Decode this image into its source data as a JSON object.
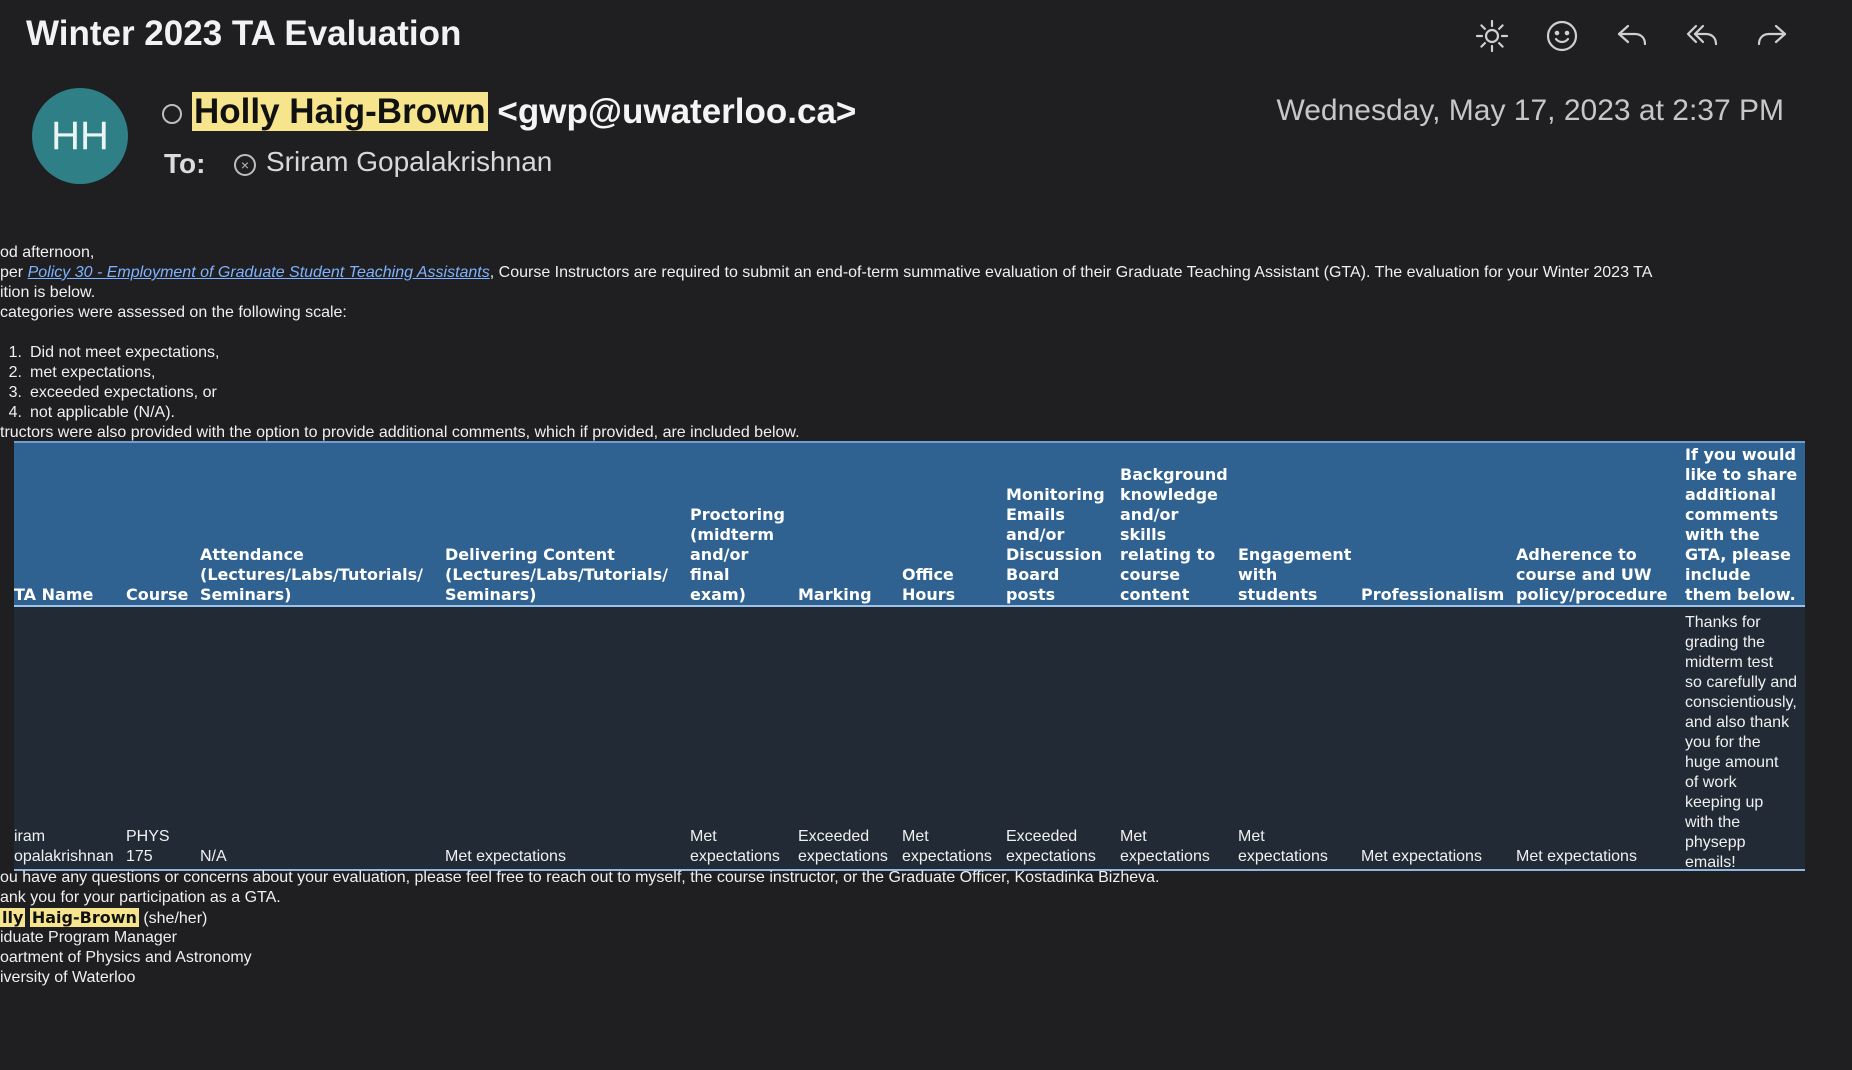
{
  "subject": "Winter 2023 TA Evaluation",
  "toolbar": [
    "sun-icon",
    "emoji-icon",
    "reply-icon",
    "reply-all-icon",
    "forward-icon"
  ],
  "avatar_initials": "HH",
  "sender_name": "Holly Haig-Brown",
  "sender_email": "<gwp@uwaterloo.ca>",
  "date": "Wednesday, May 17, 2023 at 2:37 PM",
  "to_label": "To:",
  "recipient": "Sriram Gopalakrishnan",
  "body": {
    "greeting": "od afternoon,",
    "intro_prefix": "per ",
    "policy_link": "Policy 30 - Employment of Graduate Student Teaching Assistants",
    "intro_suffix": ", Course Instructors are required  to submit an end-of-term summative evaluation of their Graduate Teaching Assistant (GTA). The evaluation for your Winter 2023 TA",
    "intro_line2": "ition is below.",
    "scale_intro": "categories were assessed on the following scale:",
    "scale": [
      "Did not meet expectations,",
      "met expectations,",
      "exceeded expectations, or",
      "not applicable (N/A)."
    ],
    "instructors_note": "tructors were also provided with the option to provide additional comments, which if provided, are included below.",
    "questions": "ou have any questions or concerns about your evaluation, please feel free to reach out to myself, the course instructor, or the Graduate Officer, Kostadinka Bizheva.",
    "thanks": "ank you for your participation as a GTA.",
    "sig_first": "lly",
    "sig_last": "Haig-Brown",
    "sig_pronouns": " (she/her)",
    "sig_title": "iduate Program Manager",
    "sig_dept": "oartment of Physics and Astronomy",
    "sig_univ": "iversity of Waterloo"
  },
  "table": {
    "headers": [
      "TA Name",
      "Course",
      "Attendance\n(Lectures/Labs/Tutorials/\nSeminars)",
      "Delivering Content\n(Lectures/Labs/Tutorials/\nSeminars)",
      "Proctoring\n(midterm\nand/or\nfinal\nexam)",
      "Marking",
      "Office\nHours",
      "Monitoring\nEmails\nand/or\nDiscussion\nBoard\nposts",
      "Background\nknowledge\nand/or\nskills\nrelating to\ncourse\ncontent",
      "Engagement\nwith\nstudents",
      "Professionalism",
      "Adherence to\ncourse and UW\npolicy/procedure",
      "If you would\nlike to share\nadditional\ncomments\nwith the\nGTA, please\ninclude\nthem below."
    ],
    "row": [
      "iram\nopalakrishnan",
      "PHYS\n175",
      "N/A",
      "Met expectations",
      "Met\nexpectations",
      "Exceeded\nexpectations",
      "Met\nexpectations",
      "Exceeded\nexpectations",
      "Met\nexpectations",
      "Met\nexpectations",
      "Met expectations",
      "Met expectations",
      "Thanks for\ngrading the\nmidterm test\nso carefully and\nconscientiously,\nand also thank\nyou for the\nhuge amount\nof work\nkeeping up\nwith the\nphysepp\nemails!"
    ]
  }
}
